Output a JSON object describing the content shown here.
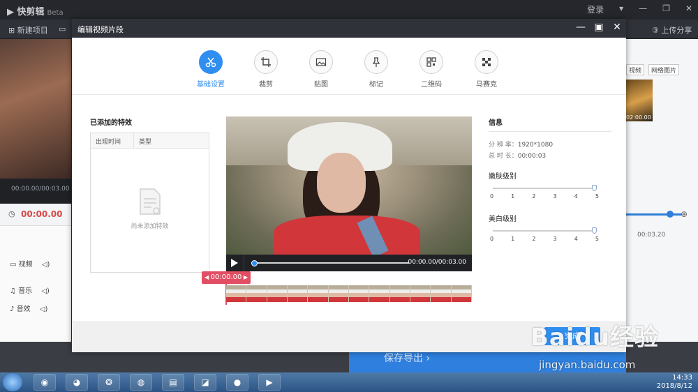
{
  "app": {
    "title": "快剪辑",
    "badge": "Beta",
    "login": "登录",
    "new_project": "新建项目",
    "upload_share": "上传分享",
    "left_time": "00:00.00/00:03.00",
    "timeline_time": "00:00.00",
    "timeline_end": "00:03.20",
    "tracks": [
      "视频",
      "音乐",
      "音效"
    ],
    "right_buttons": [
      "视频",
      "网络图片"
    ],
    "thumb_time": "02:00.00",
    "save_export": "保存导出"
  },
  "modal": {
    "title": "编辑视频片段",
    "tabs": [
      {
        "label": "基础设置",
        "icon": "scissors-icon",
        "active": true
      },
      {
        "label": "裁剪",
        "icon": "crop-icon",
        "active": false
      },
      {
        "label": "贴图",
        "icon": "image-icon",
        "active": false
      },
      {
        "label": "标记",
        "icon": "pin-icon",
        "active": false
      },
      {
        "label": "二维码",
        "icon": "qrcode-icon",
        "active": false
      },
      {
        "label": "马赛克",
        "icon": "mosaic-icon",
        "active": false
      }
    ],
    "effects": {
      "title": "已添加的特效",
      "col_time": "出现时间",
      "col_type": "类型",
      "empty_text": "尚未添加特效"
    },
    "player": {
      "time": "00:00.00/00:03.00",
      "marker_time": "00:00.00",
      "progress": 0.0
    },
    "info": {
      "title": "信息",
      "resolution_label": "分 辨 率：",
      "resolution": "1920*1080",
      "duration_label": "总 时 长：",
      "duration": "00:00:03",
      "smooth_title": "嫩肤级别",
      "smooth_level": 5,
      "whiten_title": "美白级别",
      "whiten_level": 5,
      "ticks": [
        "0",
        "1",
        "2",
        "3",
        "4",
        "5"
      ]
    },
    "done": "完成"
  },
  "taskbar": {
    "clock_time": "14:33",
    "clock_date": "2018/8/12"
  },
  "watermark": {
    "main": "Baidu经验",
    "sub": "jingyan.baidu.com"
  },
  "colors": {
    "accent": "#2f8ef0",
    "marker": "#e24e63",
    "modal_header": "#2f3238"
  }
}
